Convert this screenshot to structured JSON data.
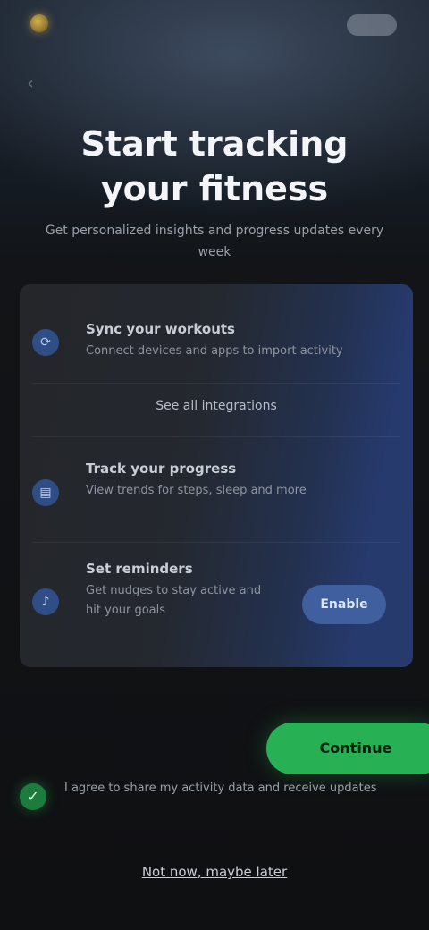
{
  "header": {
    "brand": "",
    "icons": {
      "logo": "logo-icon",
      "top_right": "account-icon",
      "back": "back-arrow-icon"
    }
  },
  "hero": {
    "title": "Start tracking your fitness",
    "subtitle": "Get personalized insights and progress updates every week"
  },
  "card": {
    "rows": [
      {
        "icon": "sync-icon",
        "title": "Sync your workouts",
        "description": "Connect devices and apps to import activity"
      },
      {
        "link": "See all integrations"
      },
      {
        "icon": "chart-icon",
        "title": "Track your progress",
        "description": "View trends for steps, sleep and more"
      },
      {
        "icon": "bell-icon",
        "title": "Set reminders",
        "description": "Get nudges to stay active and hit your goals",
        "button_label": "Enable"
      }
    ]
  },
  "cta": {
    "label": "Continue"
  },
  "consent": {
    "text": "I agree to share my activity data and receive updates"
  },
  "footer": {
    "link": "Not now, maybe later"
  },
  "colors": {
    "accent_green": "#27b154",
    "card_blue": "#263a6e",
    "background": "#0f1012"
  }
}
